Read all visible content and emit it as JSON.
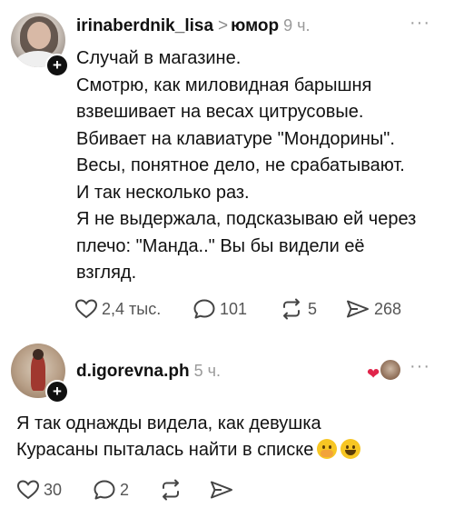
{
  "post": {
    "username": "irinaberdnik_lisa",
    "separator": ">",
    "topic": "юмор",
    "time": "9 ч.",
    "lines": [
      "Случай в магазине.",
      "Смотрю, как миловидная барышня",
      "взвешивает на весах цитрусовые.",
      "Вбивает на клавиатуре \"Мондорины\".",
      "Весы, понятное дело, не срабатывают.",
      "И так несколько раз.",
      "Я не выдержала, подсказываю ей через",
      "плечо: \"Манда..\" Вы бы видели её",
      "взгляд."
    ],
    "likes": "2,4 тыс.",
    "replies": "101",
    "reposts": "5",
    "shares": "268"
  },
  "comment": {
    "username": "d.igorevna.ph",
    "time": "5 ч.",
    "lines": [
      "Я так однажды видела, как девушка",
      "Курасаны пыталась найти в списке"
    ],
    "likes": "30",
    "replies": "2"
  },
  "icons": {
    "like": "heart-outline-icon",
    "reply": "speech-bubble-icon",
    "repost": "repost-arrows-icon",
    "share": "send-icon",
    "more": "more-dots-icon",
    "follow": "plus-icon",
    "reaction": "heart-icon"
  },
  "colors": {
    "text": "#111111",
    "muted": "#9a9a9a",
    "reaction_heart": "#e0244a"
  },
  "glyphs": {
    "more": "···",
    "plus": "+",
    "heart": "❤"
  }
}
